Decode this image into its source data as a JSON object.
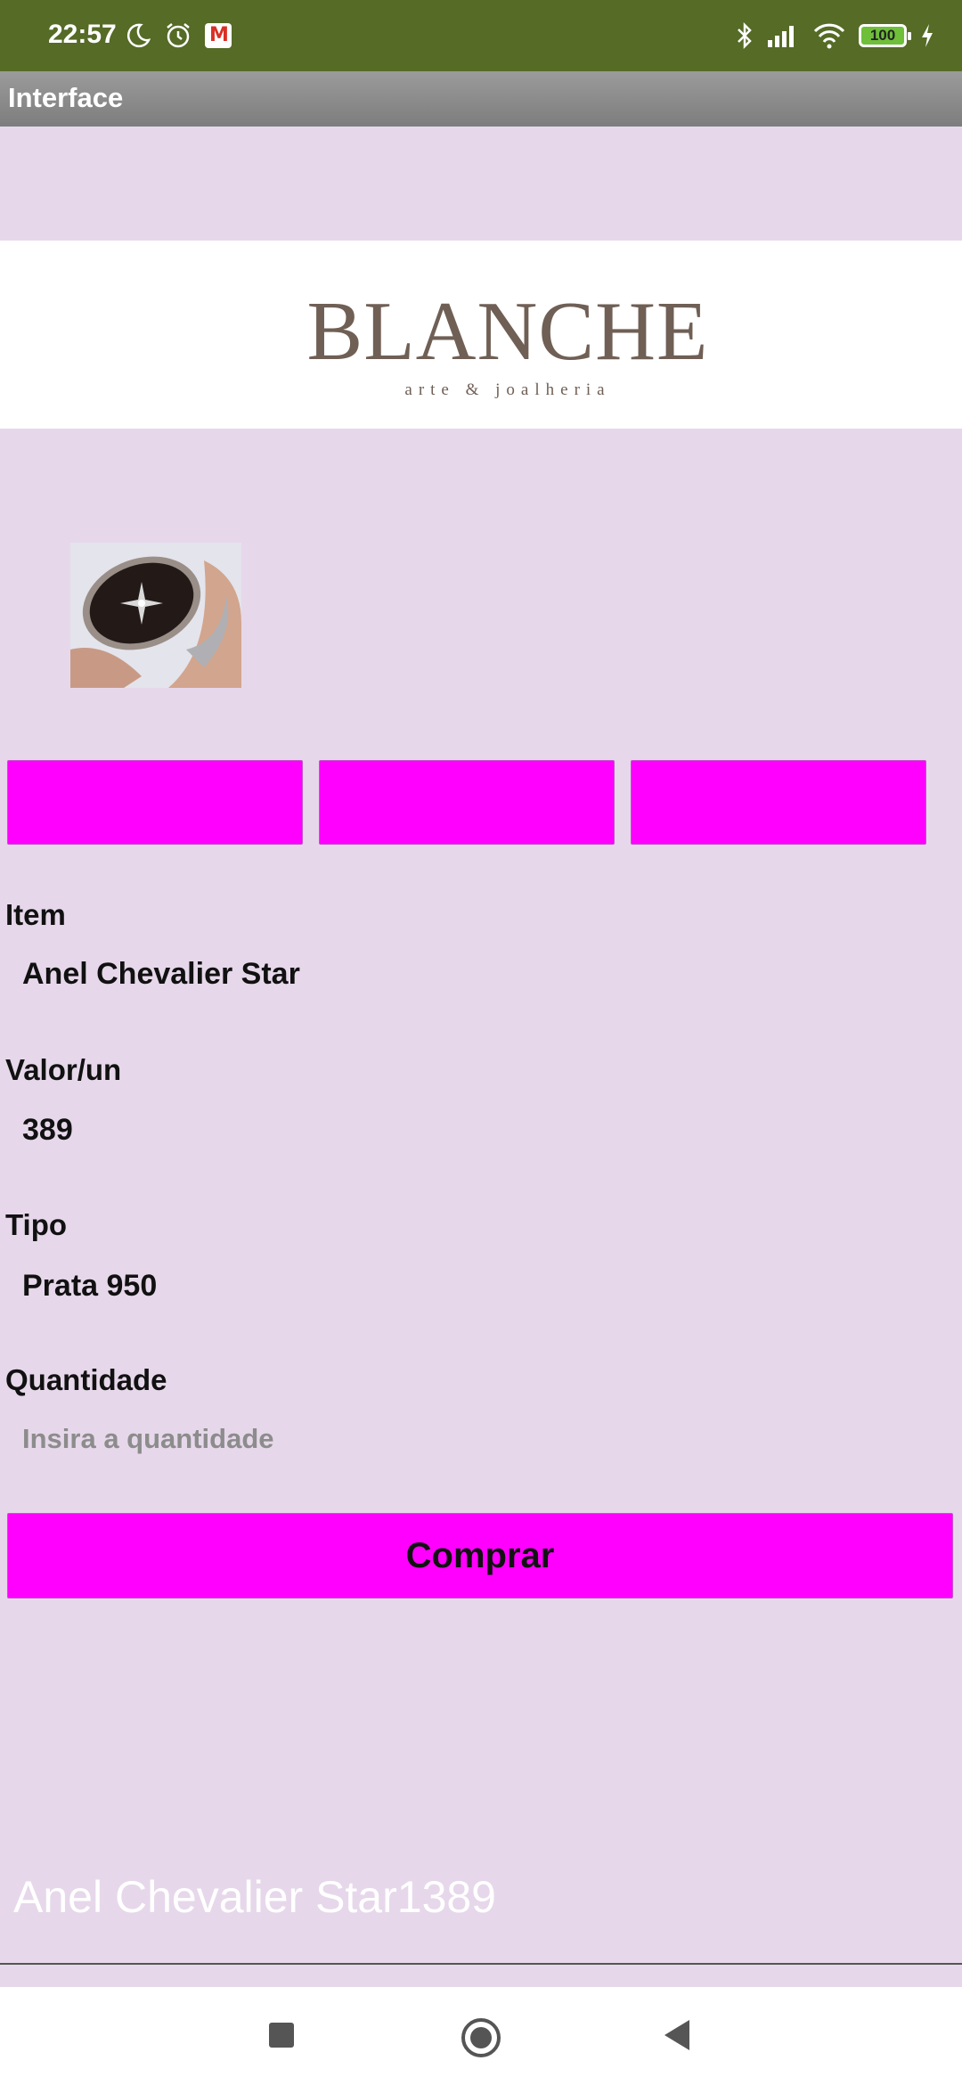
{
  "status_bar": {
    "time": "22:57",
    "battery": "100",
    "left_icons": [
      "moon-icon",
      "alarm-icon",
      "gmail-icon"
    ],
    "right_icons": [
      "bluetooth-icon",
      "signal-icon",
      "wifi-icon",
      "battery-icon",
      "charging-icon"
    ]
  },
  "app_bar": {
    "title": "Interface"
  },
  "logo": {
    "brand": "BLANCHE",
    "tagline": "arte & joalheria"
  },
  "product": {
    "item_label": "Item",
    "item_value": "Anel Chevalier Star",
    "price_label": "Valor/un",
    "price_value": "389",
    "type_label": "Tipo",
    "type_value": "Prata 950",
    "quantity_label": "Quantidade",
    "quantity_value": "",
    "quantity_placeholder": "Insira a quantidade"
  },
  "actions": {
    "buy_label": "Comprar"
  },
  "summary_text": "Anel Chevalier Star1389",
  "colors": {
    "status_bar": "#556b26",
    "app_bar": "#8a8a8a",
    "background": "#e6d8ea",
    "accent_button": "#ff00ff",
    "logo_text": "#6f5f55"
  }
}
